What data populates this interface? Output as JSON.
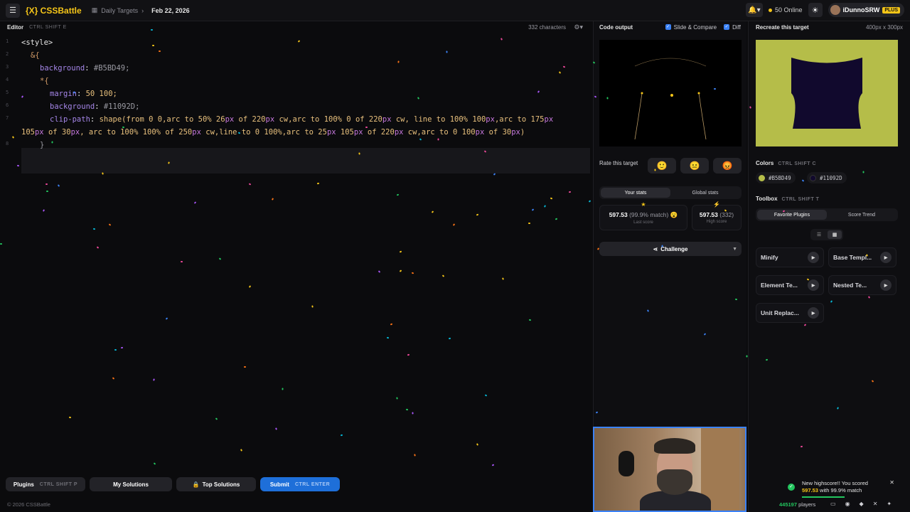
{
  "header": {
    "logo": "{X} CSSBattle",
    "crumb_section": "Daily Targets",
    "crumb_date": "Feb 22, 2026",
    "online": "50 Online",
    "username": "iDunnoSRW",
    "badge": "PLUS"
  },
  "editor": {
    "title": "Editor",
    "shortcut": "CTRL SHIFT E",
    "chars": "332 characters",
    "line_numbers": [
      "1",
      "2",
      "3",
      "4",
      "5",
      "6",
      "7",
      "",
      "8"
    ]
  },
  "output": {
    "title": "Code output",
    "slide_compare": "Slide & Compare",
    "diff": "Diff"
  },
  "rate": {
    "label": "Rate this target",
    "emojis": [
      "🙂",
      "😐",
      "😡"
    ]
  },
  "stats": {
    "tabs": [
      "Your stats",
      "Global stats"
    ],
    "last_value": "597.53",
    "last_match": "(99.9% match)",
    "last_label": "Last score",
    "high_value": "597.53",
    "high_count": "(332)",
    "high_label": "High score",
    "challenge": "Challenge"
  },
  "target": {
    "title": "Recreate this target",
    "size": "400px x 300px"
  },
  "colors": {
    "title": "Colors",
    "shortcut": "CTRL SHIFT C",
    "items": [
      {
        "hex": "#B5BD49"
      },
      {
        "hex": "#11092D"
      }
    ]
  },
  "toolbox": {
    "title": "Toolbox",
    "shortcut": "CTRL SHIFT T",
    "tabs": [
      "Favorite Plugins",
      "Score Trend"
    ],
    "plugins": [
      "Minify",
      "Base Templ...",
      "Element Te...",
      "Nested Te...",
      "Unit Replac..."
    ]
  },
  "bottom": {
    "plugins": "Plugins",
    "plugins_kbd": "CTRL SHIFT P",
    "my_solutions": "My Solutions",
    "top_solutions": "Top Solutions",
    "submit": "Submit",
    "submit_kbd": "CTRL ENTER",
    "copyright": "© 2026 CSSBattle"
  },
  "toast": {
    "line1": "New highscore!! You scored",
    "score": "597.53",
    "line2": "with 99.9% match"
  },
  "footer": {
    "players_count": "445197",
    "players_label": "players"
  },
  "theme": {
    "accent": "#3b82f6",
    "brand": "#f5c518",
    "target_bg": "#B5BD49",
    "target_fg": "#11092D"
  }
}
